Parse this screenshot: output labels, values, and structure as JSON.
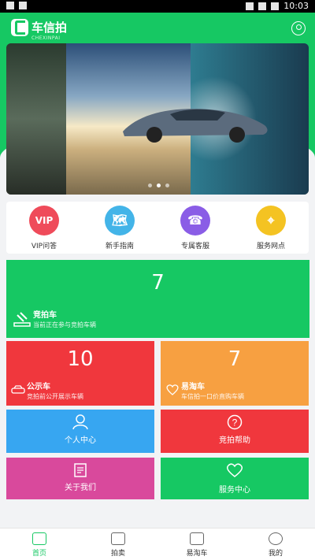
{
  "status_bar": {
    "time": "10:03"
  },
  "header": {
    "logo_cn": "车信拍",
    "logo_en": "CHEXINPAI"
  },
  "quick_links": [
    {
      "label": "VIP问答",
      "icon": "vip-icon",
      "color": "#ef4b5a",
      "glyph": "VIP"
    },
    {
      "label": "新手指南",
      "icon": "map-icon",
      "color": "#43b4e8",
      "glyph": "🗺"
    },
    {
      "label": "专属客服",
      "icon": "headset-icon",
      "color": "#8a5de6",
      "glyph": "☎"
    },
    {
      "label": "服务网点",
      "icon": "location-icon",
      "color": "#f4c322",
      "glyph": "⌖"
    }
  ],
  "tiles": {
    "auction": {
      "count": "7",
      "title": "竞拍车",
      "subtitle": "当前正在参与竞拍车辆"
    },
    "public": {
      "count": "10",
      "title": "公示车",
      "subtitle": "竞拍前公开展示车辆"
    },
    "easy": {
      "count": "7",
      "title": "易淘车",
      "subtitle": "车信拍一口价直购车辆"
    },
    "personal_center": "个人中心",
    "auction_help": "竞拍帮助",
    "about_us": "关于我们",
    "service_center": "服务中心"
  },
  "tabbar": [
    {
      "label": "首页",
      "icon": "home-icon",
      "active": true
    },
    {
      "label": "拍卖",
      "icon": "gavel-icon",
      "active": false
    },
    {
      "label": "易淘车",
      "icon": "car-icon",
      "active": false
    },
    {
      "label": "我的",
      "icon": "profile-icon",
      "active": false
    }
  ]
}
